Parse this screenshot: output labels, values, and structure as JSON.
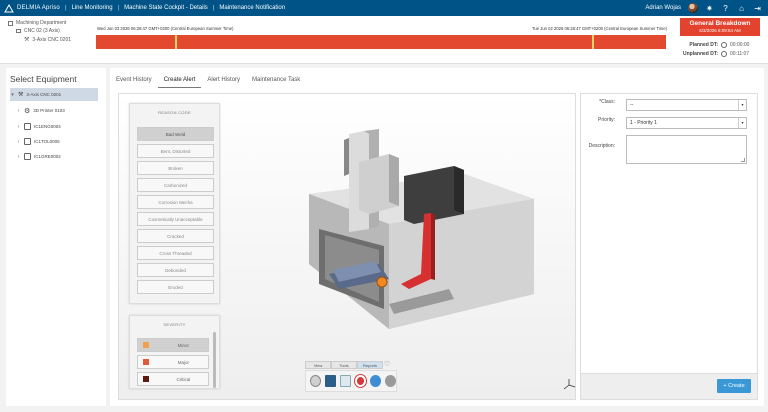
{
  "topbar": {
    "brand": "DELMIA Apriso",
    "nav": [
      "Line Monitoring",
      "Machine State Cockpit - Details",
      "Maintenance Notification"
    ],
    "user": "Adrian Wojas"
  },
  "header": {
    "tree": [
      "Machining Department",
      "CNC 02 (3 Axis)",
      "3-Axis CNC 0201"
    ],
    "timeline_start": "Wed Jun 03 2026 06:28:47 GMT+0200 (Central European Summer Time)",
    "timeline_end": "Tue Jun 02 2026 06:28:47 GMT+0200 (Central European Summer Time)",
    "status_title": "General Breakdown",
    "status_date": "6/3/2026 6:09:54 AM",
    "planned_label": "Planned DT:",
    "planned_value": "00:00:00",
    "unplanned_label": "Unplanned DT:",
    "unplanned_value": "00:11:07",
    "colors": {
      "timeline": "#e3492e",
      "breakdown": "#e2422e",
      "topbar": "#005386"
    }
  },
  "sidebar": {
    "title": "Select Equipment",
    "items": [
      {
        "label": "3-Axis CNC 0201",
        "selected": true
      },
      {
        "label": "3D Printer 0103"
      },
      {
        "label": "IC1ENG0004"
      },
      {
        "label": "IC1TOL0005"
      },
      {
        "label": "IC1GRE0002"
      }
    ]
  },
  "tabs": [
    "Event History",
    "Create Alert",
    "Alert History",
    "Maintenance Task"
  ],
  "active_tab": "Create Alert",
  "reason_code": {
    "title": "REASON CODE",
    "items": [
      "Bad Weld",
      "Bent, Distorted",
      "Broken",
      "Carbonized",
      "Corrosion Mecha",
      "Cosmetically Unacceptable",
      "Cracked",
      "Cross Threaded",
      "Debonded",
      "Eroded"
    ]
  },
  "severity": {
    "title": "SEVERITY",
    "items": [
      {
        "label": "Minor",
        "color": "#f0a050"
      },
      {
        "label": "Major",
        "color": "#e05a3a"
      },
      {
        "label": "Critical",
        "color": "#5a1a10"
      }
    ]
  },
  "viewer_toolbar": {
    "tabs": [
      "View",
      "Tools",
      "Reports"
    ]
  },
  "form": {
    "class_label": "*Class:",
    "class_value": "--",
    "priority_label": "Priority:",
    "priority_value": "1 - Priority 1",
    "description_label": "Description:",
    "create_label": "+ Create"
  }
}
